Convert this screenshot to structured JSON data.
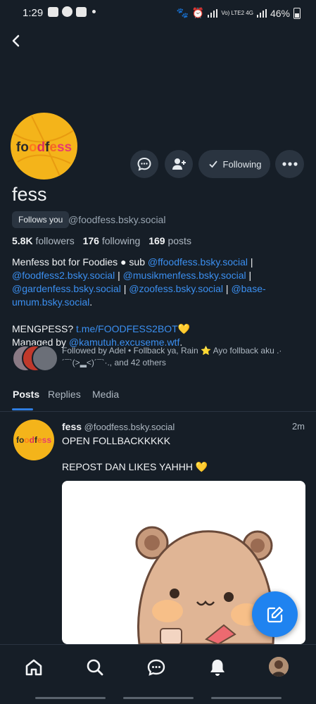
{
  "status_bar": {
    "time": "1:29",
    "battery": "46%",
    "network": "Vo) LTE2 4G"
  },
  "profile": {
    "avatar_text": [
      "f",
      "o",
      "o",
      "d",
      "f",
      "e",
      "s",
      "s"
    ],
    "display_name": "fess",
    "follows_you_label": "Follows you",
    "handle": "@foodfess.bsky.social",
    "followers_count": "5.8K",
    "followers_label": "followers",
    "following_count": "176",
    "following_label": "following",
    "posts_count": "169",
    "posts_label": "posts",
    "following_button_label": "Following",
    "bio": {
      "line1_text": "Menfess bot for Foodies ● sub ",
      "links": [
        "@ffoodfess.bsky.social",
        "@foodfess2.bsky.social",
        "@musikmenfess.bsky.social",
        "@gardenfess.bsky.social",
        "@zoofess.bsky.social",
        "@base-umum.bsky.social"
      ],
      "sep": " | ",
      "end": ".",
      "mengpess_label": "MENGPESS? ",
      "mengpess_link": "t.me/FOODFESS2BOT",
      "mengpess_emoji": "💛",
      "managed_label": "Managed by ",
      "managed_link": "@kamutuh.excuseme.wtf",
      "managed_end": "."
    },
    "followed_by": "Followed by Adel • Follback ya, Rain ⭐ Ayo follback aku .·´¯`(>▂<)´¯`·., and 42 others"
  },
  "tabs": [
    "Posts",
    "Replies",
    "Media"
  ],
  "post": {
    "author": "fess",
    "handle": "@foodfess.bsky.social",
    "time": "2m",
    "line1": "OPEN FOLLBACKKKKK",
    "line2": "REPOST DAN LIKES YAHHH 💛"
  },
  "icons": {
    "back": "chevron-left-icon",
    "message": "chat-bubble-icon",
    "add_user": "add-user-icon",
    "check": "check-icon",
    "more": "more-dots-icon",
    "compose": "compose-icon",
    "home": "home-icon",
    "search": "search-icon",
    "chat": "chat-icon",
    "notifications": "bell-icon"
  },
  "colors": {
    "background": "#161e27",
    "accent": "#1f83f0",
    "link": "#3b8ff0",
    "button_bg": "#2a3440",
    "avatar_yellow": "#f4b41a"
  }
}
